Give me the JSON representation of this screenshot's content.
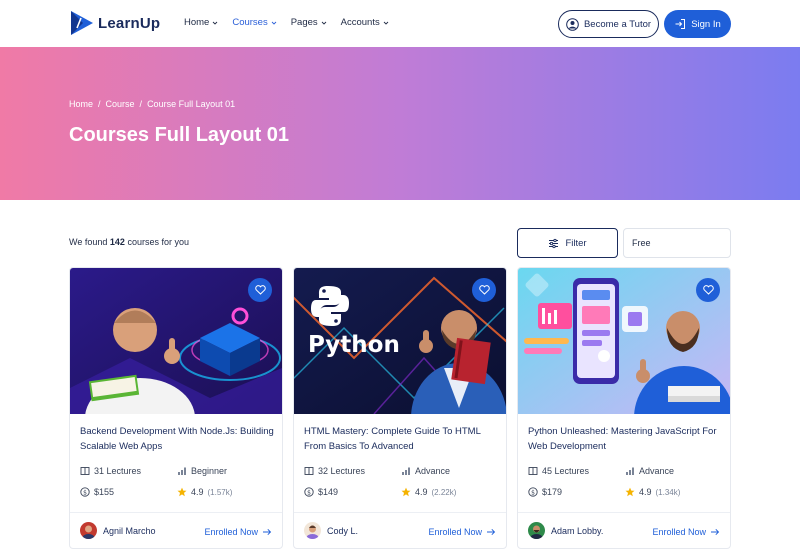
{
  "brand": {
    "name": "LearnUp"
  },
  "nav": {
    "items": [
      {
        "label": "Home",
        "active": false
      },
      {
        "label": "Courses",
        "active": true
      },
      {
        "label": "Pages",
        "active": false
      },
      {
        "label": "Accounts",
        "active": false
      }
    ],
    "become_tutor": "Become a Tutor",
    "sign_in": "Sign In"
  },
  "hero": {
    "breadcrumb": [
      "Home",
      "Course",
      "Course Full Layout 01"
    ],
    "separator": "/",
    "title": "Courses Full Layout 01"
  },
  "results": {
    "prefix": "We found",
    "count": "142",
    "suffix": "courses for you",
    "filter_label": "Filter",
    "select_value": "Free"
  },
  "colors": {
    "accent": "#1f5fd8",
    "navy": "#1a2b5c",
    "star": "#f5b301"
  },
  "courses": [
    {
      "title": "Backend Development With Node.Js: Building Scalable Web Apps",
      "lectures": "31 Lectures",
      "level": "Beginner",
      "price": "$155",
      "rating": "4.9",
      "reviews": "(1.57k)",
      "author": "Agnil Marcho",
      "enroll": "Enrolled Now",
      "image_text": ""
    },
    {
      "title": "HTML Mastery: Complete Guide To HTML From Basics To Advanced",
      "lectures": "32 Lectures",
      "level": "Advance",
      "price": "$149",
      "rating": "4.9",
      "reviews": "(2.22k)",
      "author": "Cody L.",
      "enroll": "Enrolled Now",
      "image_text": "Python"
    },
    {
      "title": "Python Unleashed: Mastering JavaScript For Web Development",
      "lectures": "45 Lectures",
      "level": "Advance",
      "price": "$179",
      "rating": "4.9",
      "reviews": "(1.34k)",
      "author": "Adam Lobby.",
      "enroll": "Enrolled Now",
      "image_text": ""
    }
  ]
}
